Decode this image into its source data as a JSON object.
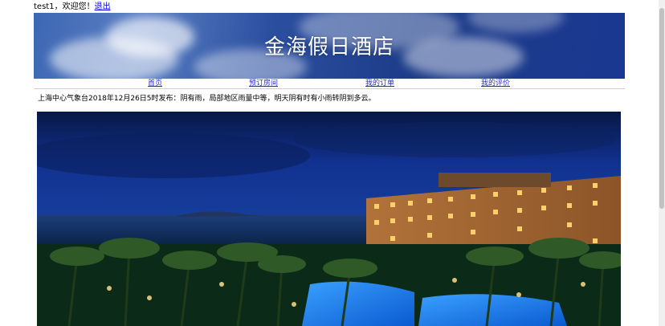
{
  "user_bar": {
    "greeting": "test1，欢迎您！",
    "logout_label": "退出"
  },
  "banner": {
    "title": "金海假日酒店"
  },
  "nav": {
    "items": [
      {
        "label": "首页"
      },
      {
        "label": "预订房间"
      },
      {
        "label": "我的订单"
      },
      {
        "label": "我的评价"
      }
    ]
  },
  "weather": {
    "text": "上海中心气象台2018年12月26日5时发布：阴有雨，局部地区雨量中等，明天阴有时有小雨转阴到多云。"
  },
  "colors": {
    "link": "#0000ee",
    "banner_blue": "#1c3b88",
    "night_sky": "#0f2c86"
  }
}
